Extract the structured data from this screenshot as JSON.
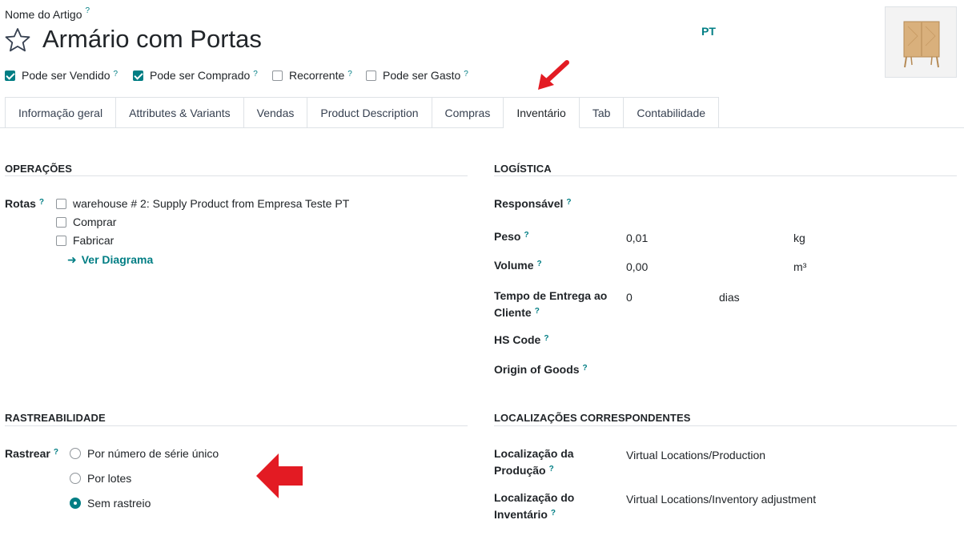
{
  "header": {
    "name_label": "Nome do Artigo",
    "help": "?",
    "product_name": "Armário com Portas",
    "lang": "PT"
  },
  "options": [
    {
      "label": "Pode ser Vendido",
      "checked": true
    },
    {
      "label": "Pode ser Comprado",
      "checked": true
    },
    {
      "label": "Recorrente",
      "checked": false
    },
    {
      "label": "Pode ser Gasto",
      "checked": false
    }
  ],
  "tabs": [
    "Informação geral",
    "Attributes & Variants",
    "Vendas",
    "Product Description",
    "Compras",
    "Inventário",
    "Tab",
    "Contabilidade"
  ],
  "operations": {
    "title": "OPERAÇÕES",
    "routes_label": "Rotas",
    "routes": [
      "warehouse # 2: Supply Product from Empresa Teste PT",
      "Comprar",
      "Fabricar"
    ],
    "diagram_link": "Ver Diagrama"
  },
  "logistics": {
    "title": "LOGÍSTICA",
    "responsible_label": "Responsável",
    "weight_label": "Peso",
    "weight_value": "0,01",
    "weight_unit": "kg",
    "volume_label": "Volume",
    "volume_value": "0,00",
    "volume_unit": "m³",
    "lead_label_1": "Tempo de Entrega ao",
    "lead_label_2": "Cliente",
    "lead_value": "0",
    "lead_unit": "dias",
    "hs_label": "HS Code",
    "origin_label": "Origin of Goods"
  },
  "traceability": {
    "title": "RASTREABILIDADE",
    "track_label": "Rastrear",
    "options": [
      {
        "label": "Por número de série único",
        "checked": false
      },
      {
        "label": "Por lotes",
        "checked": false
      },
      {
        "label": "Sem rastreio",
        "checked": true
      }
    ]
  },
  "locations": {
    "title": "LOCALIZAÇÕES CORRESPONDENTES",
    "production_label_1": "Localização da",
    "production_label_2": "Produção",
    "production_value": "Virtual Locations/Production",
    "inventory_label_1": "Localização do",
    "inventory_label_2": "Inventário",
    "inventory_value": "Virtual Locations/Inventory adjustment"
  },
  "colors": {
    "accent": "#017e84",
    "annotation_arrow": "#e31b23"
  },
  "icons": {
    "favorite": "star-outline-icon",
    "diagram": "arrow-right-icon"
  }
}
